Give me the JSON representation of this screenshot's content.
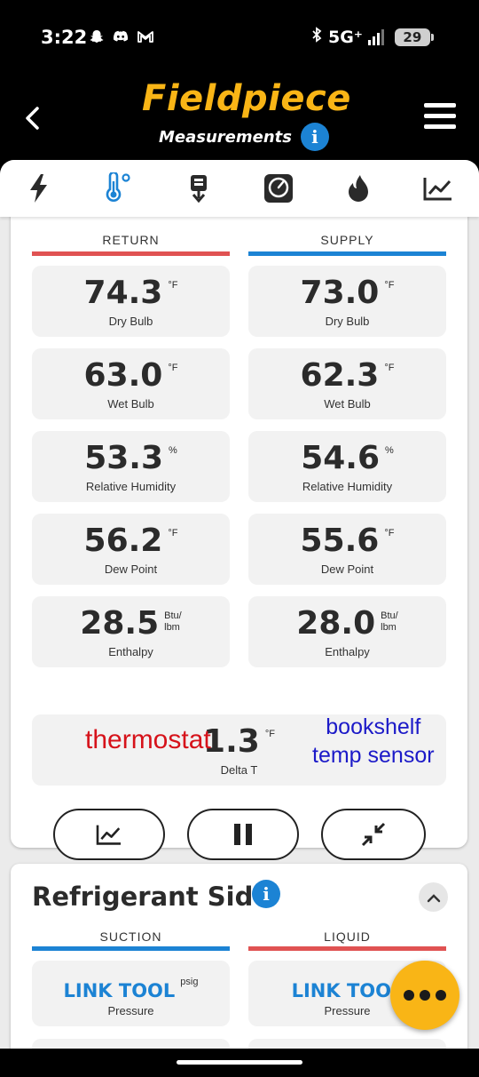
{
  "status_bar": {
    "time": "3:22",
    "network": "5G⁺",
    "battery": "29",
    "icons": [
      "snapchat-icon",
      "discord-icon",
      "gmail-icon",
      "bluetooth-icon"
    ]
  },
  "header": {
    "logo": "Fieldpiece",
    "subtitle": "Measurements",
    "info_icon": "i"
  },
  "tabs": [
    {
      "name": "electrical-tab",
      "icon": "lightning-icon",
      "active": false
    },
    {
      "name": "temperature-tab",
      "icon": "thermometer-icon",
      "active": true
    },
    {
      "name": "vacuum-tab",
      "icon": "probe-icon",
      "active": false
    },
    {
      "name": "manifold-tab",
      "icon": "gauge-icon",
      "active": false
    },
    {
      "name": "combustion-tab",
      "icon": "flame-icon",
      "active": false
    },
    {
      "name": "trend-tab",
      "icon": "chart-icon",
      "active": false
    }
  ],
  "air_side": {
    "return_header": "RETURN",
    "supply_header": "SUPPLY",
    "colors": {
      "return": "#e05252",
      "supply": "#1c83d4"
    },
    "rows": [
      {
        "label": "Dry Bulb",
        "return": "74.3",
        "supply": "73.0",
        "unit": "°F"
      },
      {
        "label": "Wet Bulb",
        "return": "63.0",
        "supply": "62.3",
        "unit": "°F"
      },
      {
        "label": "Relative Humidity",
        "return": "53.3",
        "supply": "54.6",
        "unit": "%"
      },
      {
        "label": "Dew Point",
        "return": "56.2",
        "supply": "55.6",
        "unit": "°F"
      },
      {
        "label": "Enthalpy",
        "return": "28.5",
        "supply": "28.0",
        "unit_line1": "Btu/",
        "unit_line2": "lbm"
      }
    ],
    "delta": {
      "value": "1.3",
      "unit": "°F",
      "label": "Delta T"
    },
    "annotations": {
      "left": "thermostat",
      "right_line1": "bookshelf",
      "right_line2": "temp sensor"
    },
    "controls": [
      "chart-button",
      "pause-button",
      "collapse-arrows-button"
    ]
  },
  "refrigerant_side": {
    "title": "Refrigerant Side",
    "suction_header": "SUCTION",
    "liquid_header": "LIQUID",
    "colors": {
      "suction": "#1c83d4",
      "liquid": "#e05252"
    },
    "suction_value": "LINK TOOL",
    "suction_unit": "psig",
    "liquid_value": "LINK TOOL",
    "label": "Pressure"
  },
  "accent": "#f9b516"
}
